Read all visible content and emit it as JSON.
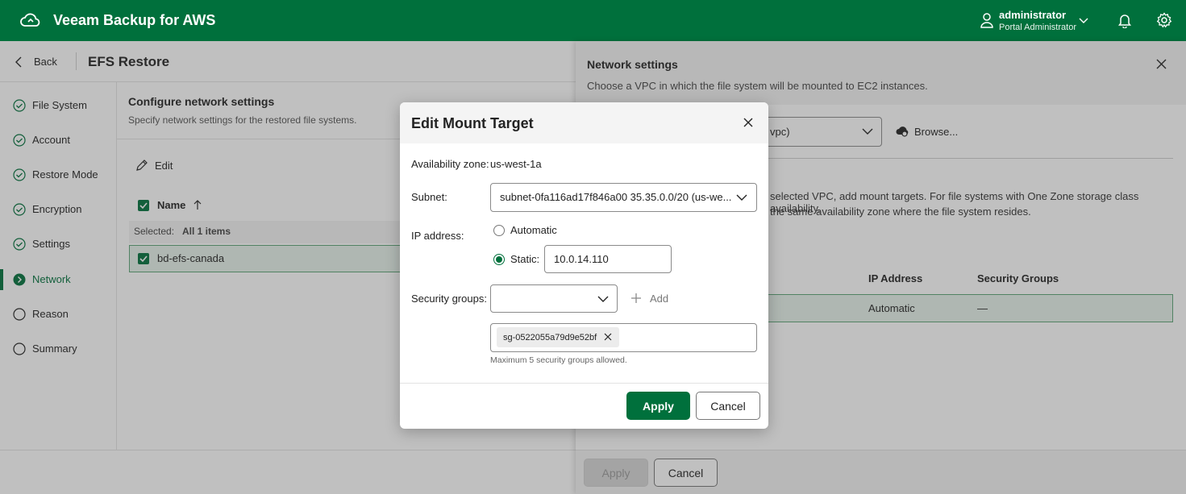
{
  "app": {
    "title": "Veeam Backup for AWS",
    "user_name": "administrator",
    "user_role": "Portal Administrator",
    "brand_color": "#00703c"
  },
  "page": {
    "back_label": "Back",
    "title": "EFS Restore"
  },
  "wizard": {
    "steps": [
      {
        "label": "File System",
        "state": "done"
      },
      {
        "label": "Account",
        "state": "done"
      },
      {
        "label": "Restore Mode",
        "state": "done"
      },
      {
        "label": "Encryption",
        "state": "done"
      },
      {
        "label": "Settings",
        "state": "done"
      },
      {
        "label": "Network",
        "state": "active"
      },
      {
        "label": "Reason",
        "state": "pending"
      },
      {
        "label": "Summary",
        "state": "pending"
      }
    ]
  },
  "network_step": {
    "title": "Configure network settings",
    "subtitle": "Specify network settings for the restored file systems.",
    "edit_label": "Edit",
    "column_name": "Name",
    "selected_label": "Selected:",
    "selected_value": "All 1 items",
    "rows": [
      {
        "name": "bd-efs-canada"
      }
    ]
  },
  "network_panel": {
    "title": "Network settings",
    "subtitle": "Choose a VPC in which the file system will be mounted to EC2 instances.",
    "vpc_value": "vpc)",
    "browse_label": "Browse...",
    "text_line1": "selected VPC, add mount targets. For file systems with One Zone storage class availability,",
    "text_line2": "the same availability zone where the file system resides.",
    "col_ip": "IP Address",
    "col_sg": "Security Groups",
    "row_ip": "Automatic",
    "row_sg": "—",
    "apply_label": "Apply",
    "cancel_label": "Cancel"
  },
  "modal": {
    "title": "Edit Mount Target",
    "az_label": "Availability zone:",
    "az_value": "us-west-1a",
    "subnet_label": "Subnet:",
    "subnet_value": "subnet-0fa116ad17f846a00 35.35.0.0/20 (us-we...",
    "ip_label": "IP address:",
    "ip_automatic_label": "Automatic",
    "ip_static_label": "Static:",
    "ip_value": "10.0.14.110",
    "sg_label": "Security groups:",
    "sg_add_label": "Add",
    "sg_tag": "sg-0522055a79d9e52bf",
    "sg_hint": "Maximum 5 security groups allowed.",
    "apply_label": "Apply",
    "cancel_label": "Cancel"
  }
}
